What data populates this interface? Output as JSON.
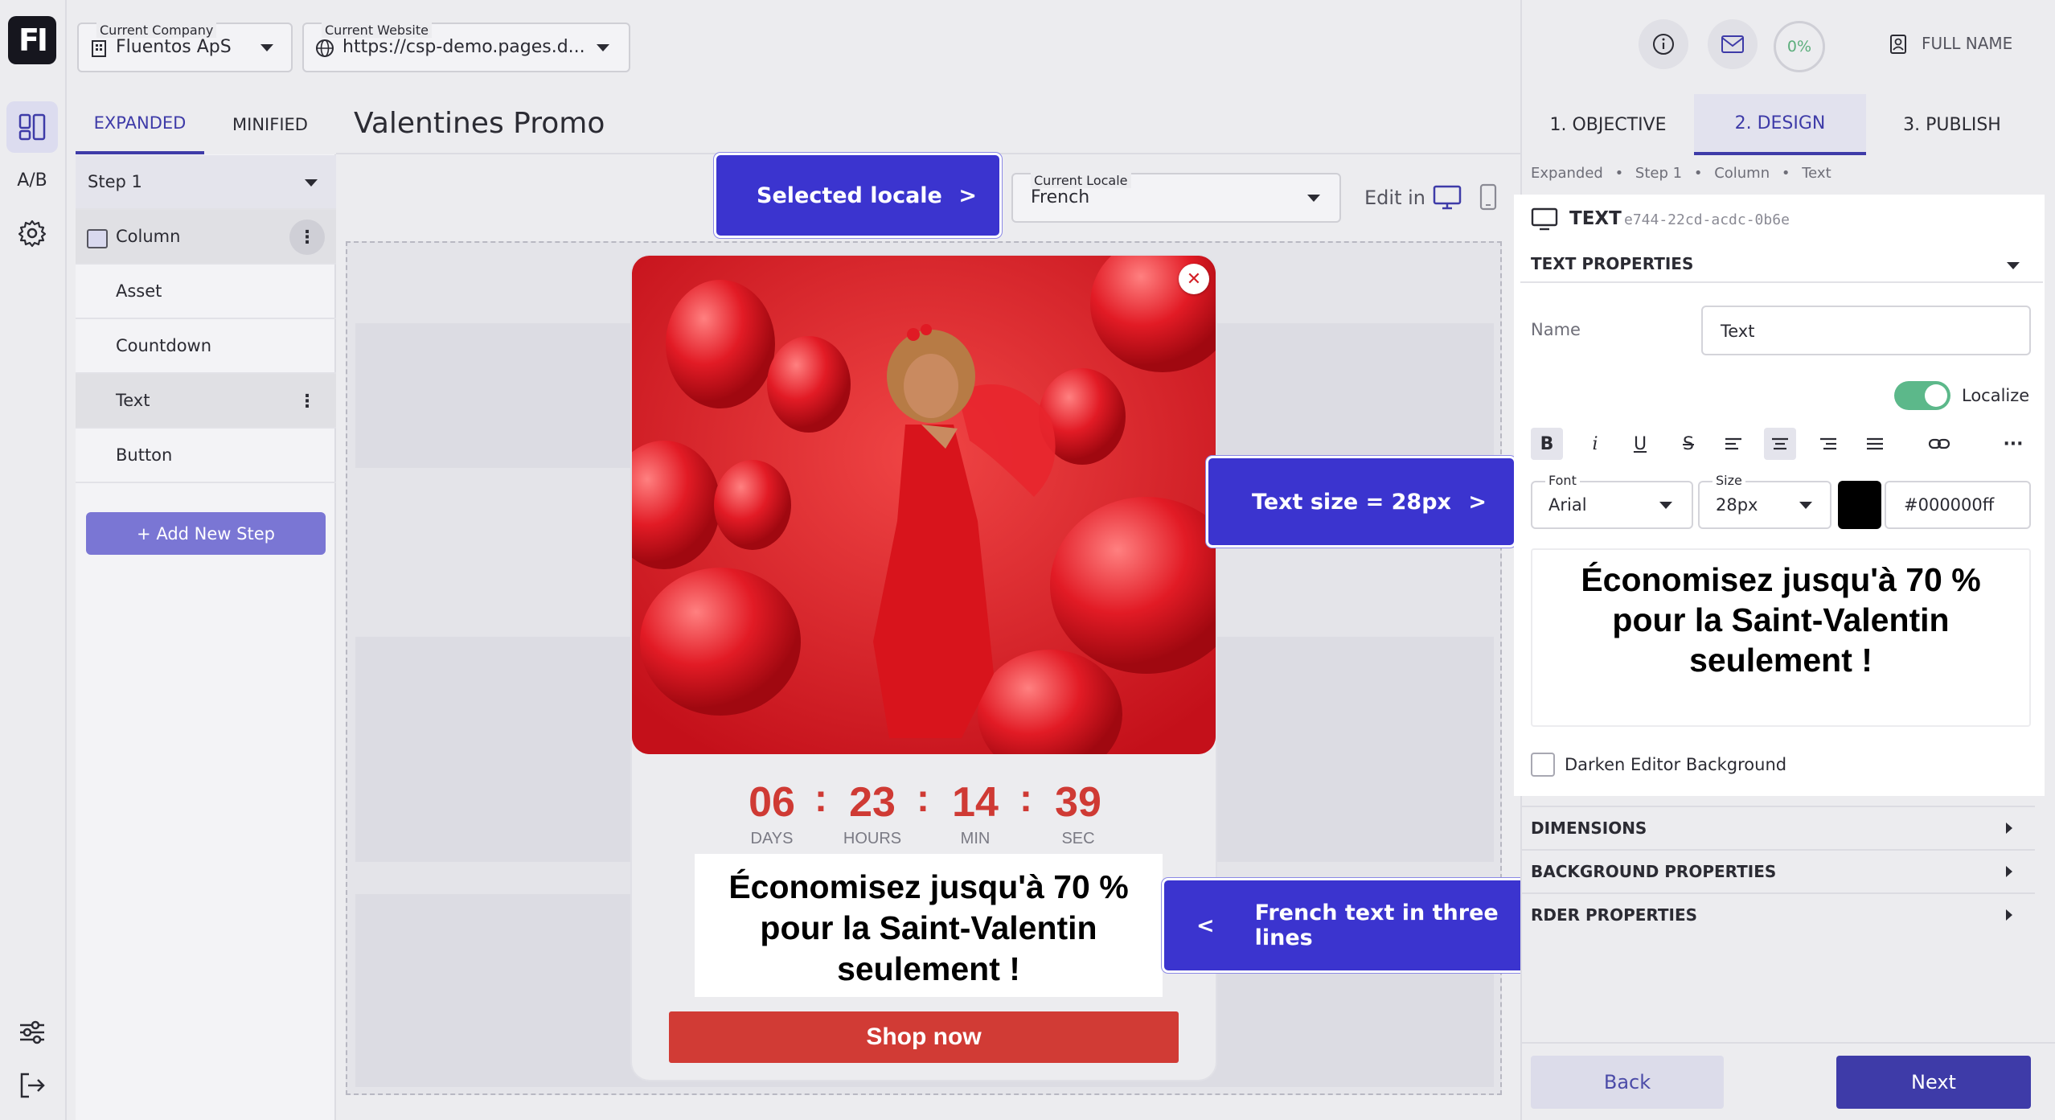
{
  "app": {
    "logo_text": "FI",
    "ab_label": "A/B"
  },
  "topbar": {
    "company_label": "Current Company",
    "company_value": "Fluentos ApS",
    "website_label": "Current Website",
    "website_value": "https://csp-demo.pages.d...",
    "progress": "0%",
    "user_name": "FULL NAME"
  },
  "tree": {
    "tabs": {
      "expanded": "EXPANDED",
      "minified": "MINIFIED"
    },
    "step_select": "Step 1",
    "items": [
      {
        "label": "Column"
      },
      {
        "label": "Asset"
      },
      {
        "label": "Countdown"
      },
      {
        "label": "Text"
      },
      {
        "label": "Button"
      }
    ],
    "add_step": "+ Add New Step"
  },
  "canvas": {
    "title": "Valentines Promo",
    "locale_label": "Current Locale",
    "locale_value": "French",
    "edit_in": "Edit in"
  },
  "popup": {
    "countdown": {
      "days": "06",
      "hours": "23",
      "min": "14",
      "sec": "39",
      "sep": ":",
      "days_label": "DAYS",
      "hours_label": "HOURS",
      "min_label": "MIN",
      "sec_label": "SEC"
    },
    "promo_line1": "Économisez jusqu'à 70 %",
    "promo_line2": "pour la Saint-Valentin",
    "promo_line3": "seulement !",
    "shop_button": "Shop now"
  },
  "callouts": {
    "locale": {
      "text": "Selected locale",
      "arrow": ">"
    },
    "size": {
      "text": "Text size = 28px",
      "arrow": ">"
    },
    "french": {
      "text": "French text in three lines",
      "arrow": "<"
    }
  },
  "right": {
    "tabs": {
      "objective": "1. OBJECTIVE",
      "design": "2. DESIGN",
      "publish": "3. PUBLISH"
    },
    "breadcrumb": [
      "Expanded",
      "Step 1",
      "Column",
      "Text"
    ],
    "breadcrumb_sep": "•",
    "element_type": "TEXT",
    "element_id": "e744-22cd-acdc-0b6e",
    "section_title": "TEXT PROPERTIES",
    "name_label": "Name",
    "name_value": "Text",
    "localize_label": "Localize",
    "localize_on": true,
    "format": {
      "bold": "B",
      "italic": "i",
      "underline": "U",
      "strike": "S",
      "more": "···"
    },
    "font_label": "Font",
    "font_value": "Arial",
    "size_label": "Size",
    "size_value": "28px",
    "color_value": "#000000ff",
    "preview_line1": "Économisez jusqu'à 70 %",
    "preview_line2": "pour la Saint-Valentin",
    "preview_line3": "seulement !",
    "darken_label": "Darken Editor Background",
    "sections": [
      "DIMENSIONS",
      "BACKGROUND PROPERTIES",
      "RDER PROPERTIES"
    ],
    "back": "Back",
    "next": "Next"
  },
  "colors": {
    "accent": "#3e3ba8",
    "callout": "#3b34cf",
    "countdown": "#cf3a34",
    "shop": "#d13b35",
    "toggle": "#5cb88a"
  }
}
